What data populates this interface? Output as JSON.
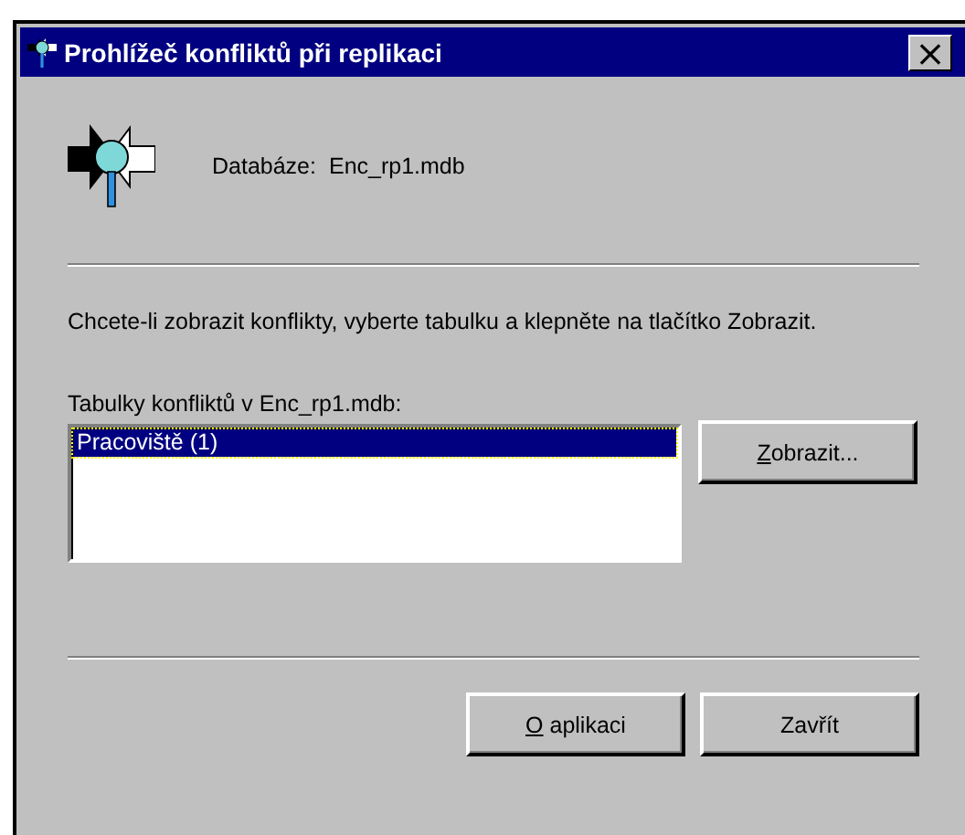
{
  "window": {
    "title": "Prohlížeč konfliktů při replikaci",
    "close": "×"
  },
  "database": {
    "label": "Databáze:",
    "value": "Enc_rp1.mdb"
  },
  "instructions": "Chcete-li zobrazit konflikty, vyberte tabulku a klepněte na tlačítko Zobrazit.",
  "tables": {
    "label": "Tabulky konfliktů v Enc_rp1.mdb:",
    "items": [
      {
        "label": "Pracoviště (1)",
        "selected": true
      }
    ]
  },
  "view_button": {
    "label": "Zobrazit...",
    "underline_first": true
  },
  "buttons": [
    {
      "label": "O aplikaci",
      "underline_first": true
    },
    {
      "label": "Zavřít",
      "underline_first": false
    }
  ]
}
